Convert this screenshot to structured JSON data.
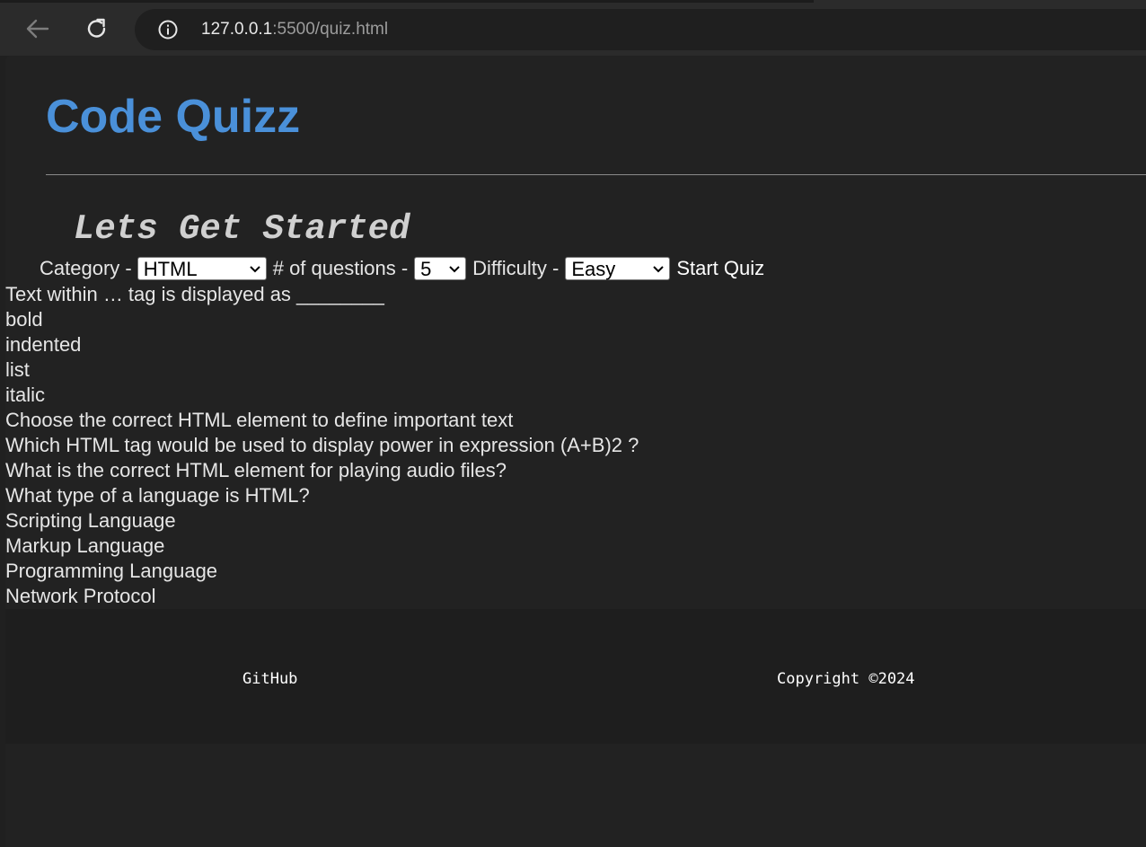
{
  "browser": {
    "url_host": "127.0.0.1",
    "url_rest": ":5500/quiz.html",
    "back_icon": "back-arrow-icon",
    "reload_icon": "reload-icon",
    "info_icon": "info-icon"
  },
  "page": {
    "title": "Code Quizz",
    "subtitle": "Lets Get Started",
    "accent_color": "#4a90d9",
    "background_color": "#222222"
  },
  "controls": {
    "category_label": "Category -",
    "category_value": "HTML",
    "count_label": "# of questions -",
    "count_value": "5",
    "difficulty_label": "Difficulty -",
    "difficulty_value": "Easy",
    "start_label": "Start Quiz"
  },
  "quiz": {
    "questions": [
      {
        "text": "Text within … tag is displayed as ________",
        "answers": [
          "bold",
          "indented",
          "list",
          "italic"
        ]
      },
      {
        "text": "Choose the correct HTML element to define important text",
        "answers": []
      },
      {
        "text": "Which HTML tag would be used to display power in expression (A+B)2 ?",
        "answers": []
      },
      {
        "text": "What is the correct HTML element for playing audio files?",
        "answers": []
      },
      {
        "text": "What type of a language is HTML?",
        "answers": [
          "Scripting Language",
          "Markup Language",
          "Programming Language",
          "Network Protocol"
        ]
      }
    ]
  },
  "footer": {
    "github_label": "GitHub",
    "copyright": "Copyright ©2024"
  }
}
